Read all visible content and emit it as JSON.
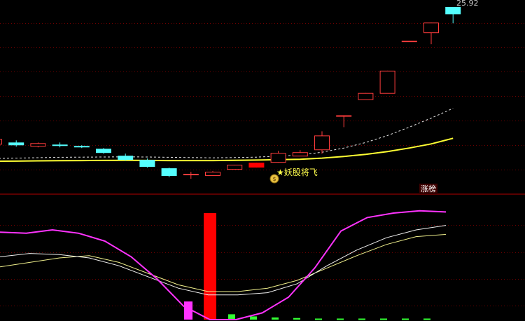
{
  "colors": {
    "background": "#000000",
    "grid": "#6e0000",
    "divider": "#b40000",
    "up": "#ff3c3c",
    "up_fill": "#ff0000",
    "down": "#54ffff",
    "ma_yellow": "#ffff33",
    "ma_dashed": "#e8e8e8",
    "osc_magenta": "#ff33ff",
    "osc_white": "#f0f0f0",
    "osc_yellow": "#f0f08c",
    "green_bar": "#33ff33",
    "signal_text": "#ffff4c",
    "badge_bg": "#3c0000",
    "badge_text": "#ffffff"
  },
  "price_label": "25.92",
  "signal": {
    "icon": "money-bag-icon",
    "text": "★妖股将飞"
  },
  "badge": "涨榜",
  "chart_data": {
    "type": "candlestick",
    "price_panel": {
      "candles": [
        {
          "o": 16.1,
          "c": 16.45,
          "h": 16.5,
          "l": 16.05
        },
        {
          "o": 16.2,
          "c": 16.0,
          "h": 16.35,
          "l": 15.9
        },
        {
          "o": 15.95,
          "c": 16.15,
          "h": 16.2,
          "l": 15.85
        },
        {
          "o": 16.05,
          "c": 15.95,
          "h": 16.2,
          "l": 15.85
        },
        {
          "o": 15.95,
          "c": 15.85,
          "h": 16.0,
          "l": 15.8
        },
        {
          "o": 15.75,
          "c": 15.45,
          "h": 15.8,
          "l": 15.4
        },
        {
          "o": 15.25,
          "c": 14.95,
          "h": 15.4,
          "l": 14.9
        },
        {
          "o": 14.95,
          "c": 14.45,
          "h": 15.05,
          "l": 14.4
        },
        {
          "o": 14.35,
          "c": 13.8,
          "h": 14.4,
          "l": 13.7
        },
        {
          "o": 13.95,
          "c": 13.95,
          "h": 14.1,
          "l": 13.6
        },
        {
          "o": 13.85,
          "c": 14.1,
          "h": 14.15,
          "l": 13.85
        },
        {
          "o": 14.3,
          "c": 14.6,
          "h": 14.6,
          "l": 14.3
        },
        {
          "o": 14.4,
          "c": 14.75,
          "h": 14.75,
          "l": 14.4
        },
        {
          "o": 14.8,
          "c": 15.45,
          "h": 15.6,
          "l": 14.75
        },
        {
          "o": 15.25,
          "c": 15.5,
          "h": 15.65,
          "l": 15.25
        },
        {
          "o": 15.7,
          "c": 16.7,
          "h": 17.0,
          "l": 15.4
        },
        {
          "o": 18.15,
          "c": 18.15,
          "h": 18.15,
          "l": 17.3
        },
        {
          "o": 19.3,
          "c": 19.75,
          "h": 19.75,
          "l": 19.3
        },
        {
          "o": 19.75,
          "c": 21.35,
          "h": 21.35,
          "l": 19.75
        },
        {
          "o": 23.5,
          "c": 23.5,
          "h": 23.5,
          "l": 23.5
        },
        {
          "o": 24.1,
          "c": 24.8,
          "h": 24.8,
          "l": 23.25
        },
        {
          "o": 25.92,
          "c": 25.4,
          "h": 25.92,
          "l": 24.75
        }
      ],
      "ma_yellow": [
        14.85,
        14.86,
        14.88,
        14.89,
        14.9,
        14.91,
        14.92,
        14.91,
        14.9,
        14.9,
        14.9,
        14.92,
        14.94,
        14.97,
        15.0,
        15.08,
        15.2,
        15.35,
        15.55,
        15.8,
        16.1,
        16.5
      ],
      "ma_dashed": [
        15.05,
        15.08,
        15.11,
        15.14,
        15.15,
        15.16,
        15.17,
        15.16,
        15.14,
        15.12,
        15.1,
        15.12,
        15.15,
        15.22,
        15.3,
        15.5,
        15.8,
        16.2,
        16.7,
        17.3,
        17.95,
        18.65
      ]
    },
    "indicator_panel": {
      "magenta_line": [
        0.78,
        0.77,
        0.8,
        0.77,
        0.7,
        0.56,
        0.36,
        0.12,
        0.0,
        0.0,
        0.06,
        0.2,
        0.46,
        0.79,
        0.91,
        0.95,
        0.97,
        0.96
      ],
      "white_line": [
        0.56,
        0.59,
        0.58,
        0.55,
        0.48,
        0.38,
        0.28,
        0.22,
        0.22,
        0.24,
        0.32,
        0.48,
        0.62,
        0.73,
        0.8,
        0.84
      ],
      "yellow_line": [
        0.47,
        0.51,
        0.55,
        0.57,
        0.51,
        0.41,
        0.31,
        0.25,
        0.25,
        0.28,
        0.35,
        0.46,
        0.57,
        0.67,
        0.74,
        0.76
      ],
      "bars": [
        {
          "value": 0.17,
          "color": "magenta"
        },
        {
          "value": 1.0,
          "color": "red"
        },
        {
          "value": 0.05,
          "color": "green"
        },
        {
          "value": 0.03,
          "color": "green"
        },
        {
          "value": 0.02,
          "color": "green"
        },
        {
          "value": 0.015,
          "color": "green"
        },
        {
          "value": 0.01,
          "color": "green"
        },
        {
          "value": 0.01,
          "color": "green"
        },
        {
          "value": 0.01,
          "color": "green"
        },
        {
          "value": 0.01,
          "color": "green"
        },
        {
          "value": 0.01,
          "color": "green"
        },
        {
          "value": 0.01,
          "color": "green"
        }
      ]
    }
  }
}
